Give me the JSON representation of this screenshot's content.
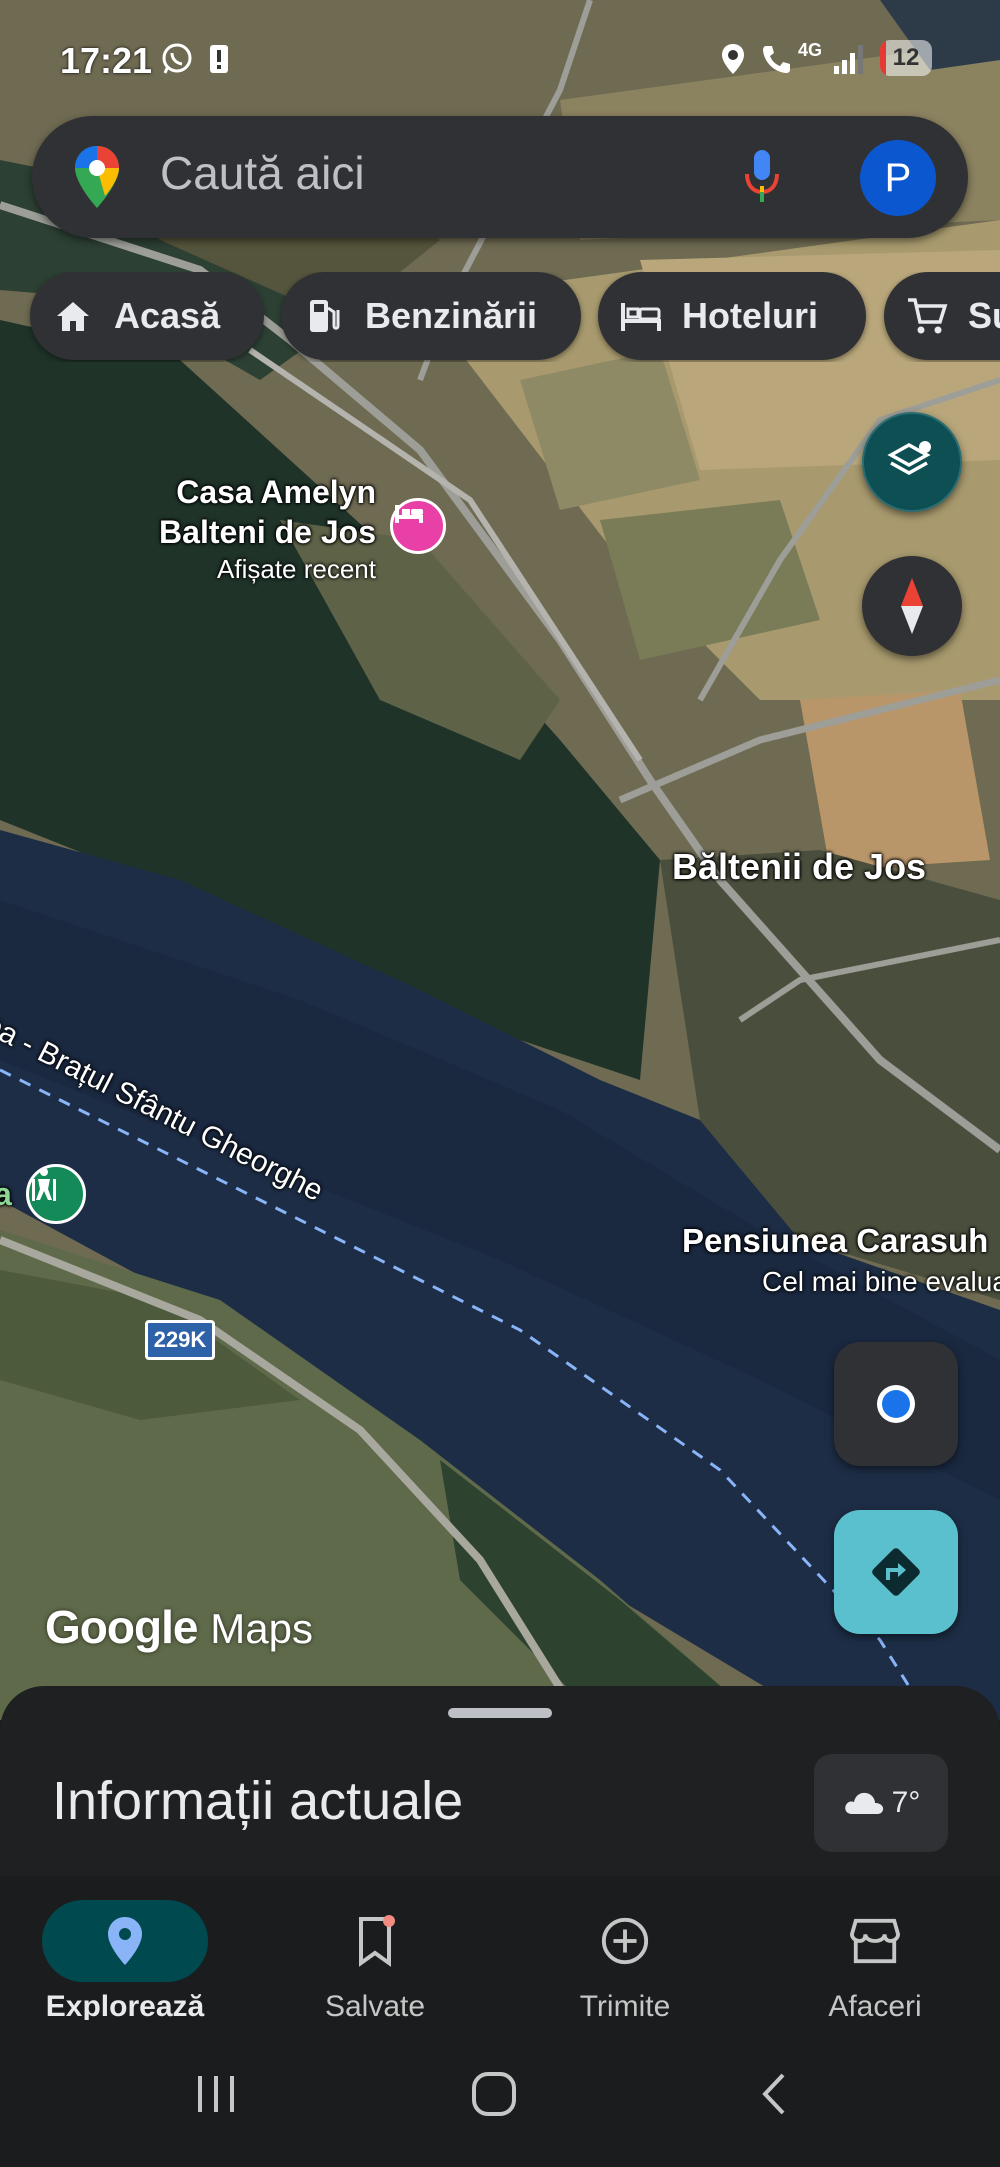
{
  "status_bar": {
    "time": "17:21",
    "network": "4G",
    "battery": "12",
    "icons": [
      "whatsapp-icon",
      "alert-icon",
      "location-icon",
      "wifi-call-icon",
      "signal-icon"
    ]
  },
  "search": {
    "placeholder": "Caută aici",
    "avatar_initial": "P",
    "icons": [
      "maps-pin-icon",
      "mic-icon"
    ]
  },
  "chips": [
    {
      "label": "Acasă",
      "icon": "home-icon"
    },
    {
      "label": "Benzinării",
      "icon": "gas-station-icon"
    },
    {
      "label": "Hoteluri",
      "icon": "bed-icon"
    },
    {
      "label": "Su",
      "icon": "cart-icon"
    }
  ],
  "map": {
    "places": {
      "casa_amelyn": {
        "name_line1": "Casa Amelyn",
        "name_line2": "Balteni de Jos",
        "sub": "Afișate recent"
      },
      "village": {
        "name": "Băltenii de Jos"
      },
      "pensiune": {
        "name": "Pensiunea Carasuh",
        "sub": "Cel mai bine evalua"
      }
    },
    "river_label": "ea - Brațul Sfântu Gheorghe",
    "edge_label": "a",
    "route_shield": "229K",
    "logo": {
      "brand": "Google",
      "product": "Maps"
    }
  },
  "sheet": {
    "title": "Informații actuale",
    "temperature": "7°"
  },
  "nav": [
    {
      "label": "Explorează",
      "icon": "explore-pin-icon",
      "active": true
    },
    {
      "label": "Salvate",
      "icon": "bookmark-icon",
      "active": false,
      "badge": true
    },
    {
      "label": "Trimite",
      "icon": "add-circle-icon",
      "active": false
    },
    {
      "label": "Afaceri",
      "icon": "storefront-icon",
      "active": false
    }
  ],
  "colors": {
    "accent": "#8ab4f8",
    "active_pill": "#004a4f",
    "fab_teal": "#5bc0cd",
    "layers_fab": "#0d4f53",
    "hotel_pin": "#e940a8",
    "hiking_pin": "#138a57"
  }
}
